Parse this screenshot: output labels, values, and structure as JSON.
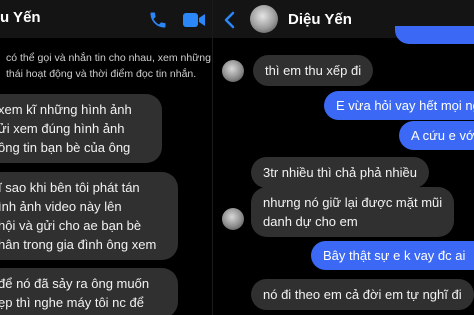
{
  "left_chat": {
    "contact_name": "u Yến",
    "icons": {
      "call": "phone-icon",
      "video": "video-camera-icon"
    },
    "privacy_notice": [
      "có thể gọi và nhắn tin cho nhau, xem những",
      "thái hoạt động và thời điểm đọc tin nhắn."
    ],
    "messages": [
      {
        "lines": [
          "xem kĩ những hình ảnh",
          "ửi xem đúng hình ảnh",
          "ông tin bạn bè của ông"
        ]
      },
      {
        "lines": [
          "ĩ sao khi bên tôi phát tán",
          "ình ảnh video này lên",
          "hội và gửi cho ae bạn bè",
          "hân trong gia đình ông xem"
        ]
      },
      {
        "lines": [
          "để nó đã sảy ra ông muốn",
          "ẹp thì nghe máy tôi nc để"
        ]
      }
    ]
  },
  "right_chat": {
    "back_icon": "chevron-left-icon",
    "contact_name": "Diệu Yến",
    "icons": {
      "call": "phone-icon",
      "video": "video-camera-icon"
    },
    "messages": [
      {
        "from": "them",
        "text": "thì em thu xếp đi"
      },
      {
        "from": "me",
        "text": "E vừa hỏi vay hết mọi ng"
      },
      {
        "from": "me",
        "text": "A cứu e với"
      },
      {
        "from": "them",
        "text": "3tr nhiều thì chả phả nhiều"
      },
      {
        "from": "them",
        "lines": [
          "nhưng nó giữ lại được mặt mũi",
          "danh dự cho em"
        ]
      },
      {
        "from": "me",
        "text": "Bây thật sự e k vay đc ai"
      },
      {
        "from": "them",
        "text": "nó đi theo em cả đời em tự nghĩ đi"
      }
    ]
  },
  "colors": {
    "accent_blue": "#3b69f5",
    "icon_blue": "#2b86f7",
    "incoming_bubble": "#303030",
    "background": "#000000"
  }
}
